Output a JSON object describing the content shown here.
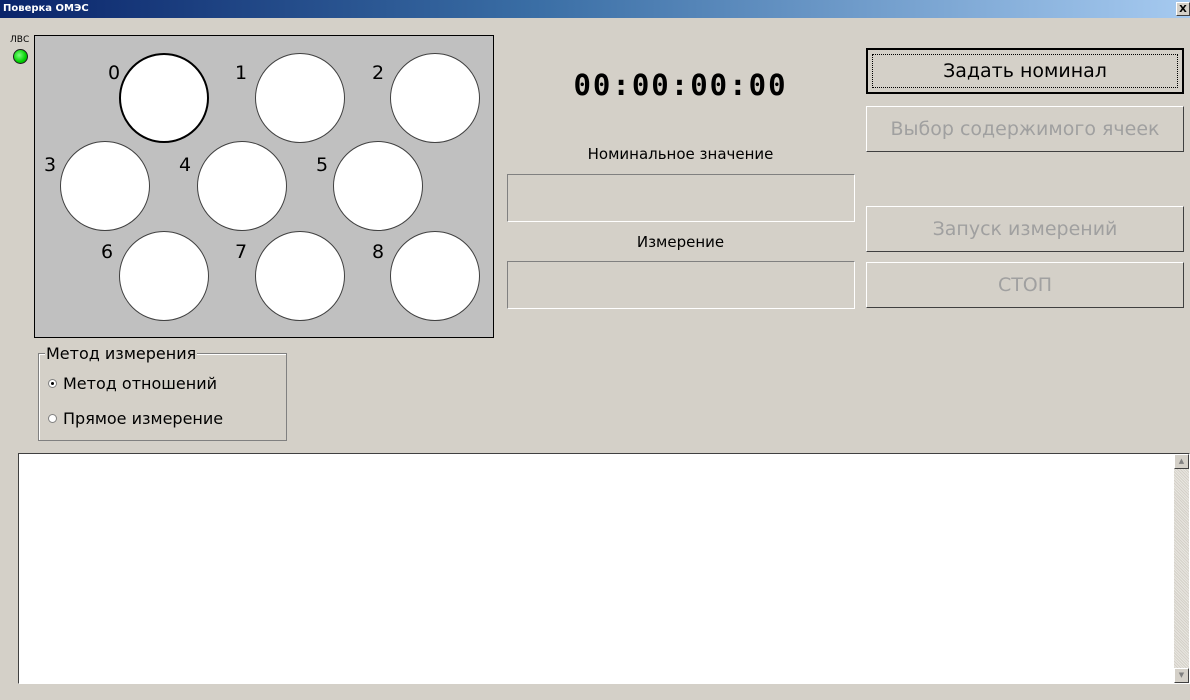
{
  "window": {
    "title": "Поверка ОМЭС",
    "close_glyph": "X"
  },
  "indicator": {
    "label": "ЛВС",
    "color": "#00d000"
  },
  "cells": {
    "items": [
      {
        "label": "0",
        "selected": true
      },
      {
        "label": "1",
        "selected": false
      },
      {
        "label": "2",
        "selected": false
      },
      {
        "label": "3",
        "selected": false
      },
      {
        "label": "4",
        "selected": false
      },
      {
        "label": "5",
        "selected": false
      },
      {
        "label": "6",
        "selected": false
      },
      {
        "label": "7",
        "selected": false
      },
      {
        "label": "8",
        "selected": false
      }
    ]
  },
  "timer": {
    "value": "00:00:00:00"
  },
  "nominal": {
    "label": "Номинальное значение",
    "value": ""
  },
  "measurement": {
    "label": "Измерение",
    "value": ""
  },
  "buttons": {
    "set_nominal": "Задать номинал",
    "select_cells": "Выбор содержимого ячеек",
    "start": "Запуск измерений",
    "stop": "СТОП"
  },
  "method": {
    "title": "Метод измерения",
    "options": [
      {
        "label": "Метод отношений",
        "checked": true
      },
      {
        "label": "Прямое измерение",
        "checked": false
      }
    ]
  },
  "log": {
    "text": ""
  }
}
